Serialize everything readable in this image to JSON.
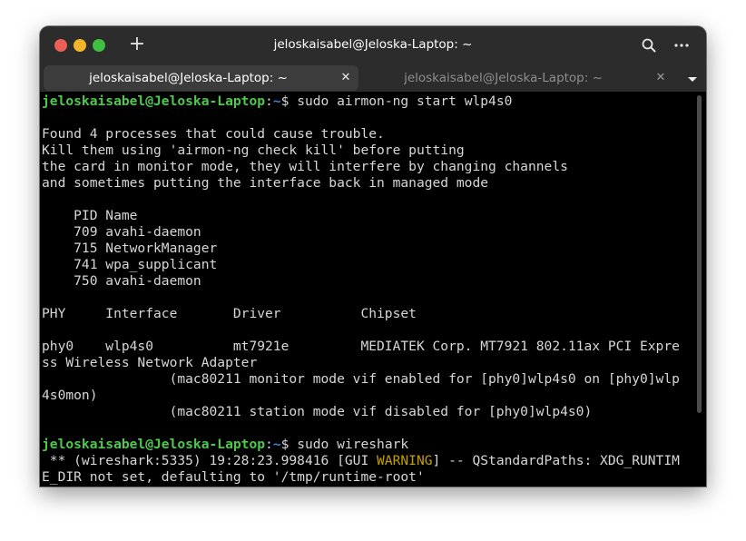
{
  "window": {
    "title": "jeloskaisabel@Jeloska-Laptop: ~",
    "new_tab_symbol": "+",
    "icons": [
      "close-window-icon",
      "minimize-window-icon",
      "maximize-window-icon",
      "plus-icon",
      "search-icon",
      "more-menu-icon",
      "chevron-down-icon",
      "close-icon"
    ],
    "colors": {
      "close": "#ec5f57",
      "minimize": "#f0b529",
      "maximize": "#3fc040",
      "prompt_user": "#4ec94e",
      "prompt_path": "#3f86d8",
      "warning": "#c4a000",
      "text": "#d7d7d7",
      "background": "#000000"
    }
  },
  "tabs": [
    {
      "label": "jeloskaisabel@Jeloska-Laptop: ~",
      "close": "✕",
      "active": true
    },
    {
      "label": "jeloskaisabel@Jeloska-Laptop: ~",
      "close": "✕",
      "active": false
    }
  ],
  "terminal": {
    "prompt_user": "jeloskaisabel@Jeloska-Laptop",
    "prompt_sep": ":",
    "prompt_path": "~",
    "prompt_symbol": "$ ",
    "command1": "sudo airmon-ng start wlp4s0",
    "lines1": [
      "",
      "Found 4 processes that could cause trouble.",
      "Kill them using 'airmon-ng check kill' before putting",
      "the card in monitor mode, they will interfere by changing channels",
      "and sometimes putting the interface back in managed mode",
      "",
      "    PID Name",
      "    709 avahi-daemon",
      "    715 NetworkManager",
      "    741 wpa_supplicant",
      "    750 avahi-daemon",
      "",
      "PHY     Interface       Driver          Chipset",
      "",
      "phy0    wlp4s0          mt7921e         MEDIATEK Corp. MT7921 802.11ax PCI Expre",
      "ss Wireless Network Adapter",
      "                (mac80211 monitor mode vif enabled for [phy0]wlp4s0 on [phy0]wlp",
      "4s0mon)",
      "                (mac80211 station mode vif disabled for [phy0]wlp4s0)",
      ""
    ],
    "command2": "sudo wireshark",
    "warn_prefix": " ** (wireshark:5335) 19:28:23.998416 [GUI ",
    "warn_word": "WARNING",
    "warn_suffix": "] -- QStandardPaths: XDG_RUNTIM",
    "last_line": "E_DIR not set, defaulting to '/tmp/runtime-root'"
  }
}
